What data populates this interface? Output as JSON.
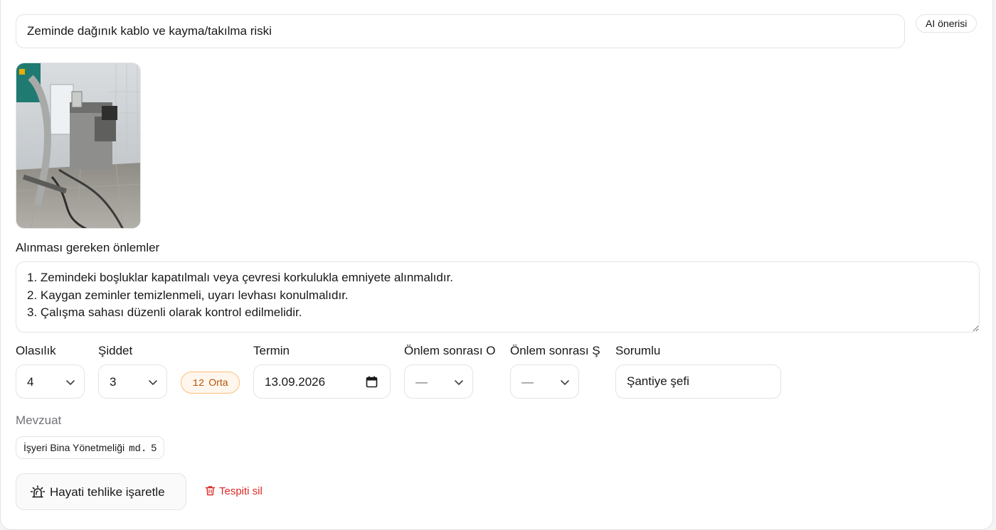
{
  "finding": {
    "title": "Zeminde dağınık kablo ve kayma/takılma riski",
    "ai_button": "AI önerisi"
  },
  "measures": {
    "label": "Alınması gereken önlemler",
    "text": "1. Zemindeki boşluklar kapatılmalı veya çevresi korkulukla emniyete alınmalıdır.\n2. Kaygan zeminler temizlenmeli, uyarı levhası konulmalıdır.\n3. Çalışma sahası düzenli olarak kontrol edilmelidir."
  },
  "fields": {
    "probability": {
      "label": "Olasılık",
      "value": "4"
    },
    "severity": {
      "label": "Şiddet",
      "value": "3"
    },
    "risk": {
      "score": "12",
      "level": "Orta"
    },
    "deadline": {
      "label": "Termin",
      "value": "13.09.2026"
    },
    "post_probability": {
      "label": "Önlem sonrası O",
      "value": "—"
    },
    "post_severity": {
      "label": "Önlem sonrası Ş",
      "value": "—"
    },
    "responsible": {
      "label": "Sorumlu",
      "value": "Şantiye şefi"
    }
  },
  "regulation": {
    "label": "Mevzuat",
    "chip_name": "İşyeri Bina Yönetmeliği",
    "chip_article": "md.",
    "chip_number": "5"
  },
  "actions": {
    "danger_button": "Hayati tehlike işaretle",
    "delete_link": "Tespiti sil"
  },
  "icons": {
    "chevron": "chevron-down-icon",
    "calendar": "calendar-icon",
    "alarm": "siren-icon",
    "trash": "trash-icon"
  },
  "colors": {
    "risk_badge_text": "#b45309",
    "risk_badge_bg": "#fff7ed",
    "danger_text": "#dc2626"
  }
}
